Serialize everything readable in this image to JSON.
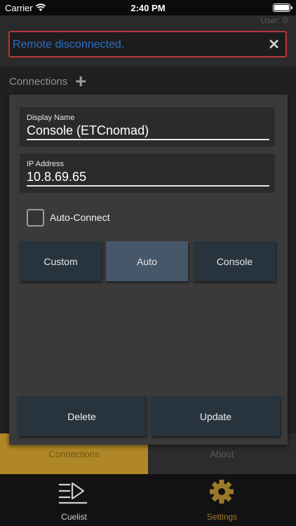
{
  "status_bar": {
    "carrier": "Carrier",
    "time": "2:40 PM"
  },
  "header": {
    "user_label": "User: 0",
    "alert": {
      "message": "Remote disconnected.",
      "close_glyph": "✕"
    }
  },
  "connections": {
    "label": "Connections",
    "add_glyph": "+"
  },
  "form": {
    "display_name": {
      "label": "Display Name",
      "value": "Console (ETCnomad)"
    },
    "ip_address": {
      "label": "IP Address",
      "value": "10.8.69.65"
    },
    "auto_connect": {
      "label": "Auto-Connect",
      "checked": false
    },
    "mode": {
      "options": [
        "Custom",
        "Auto",
        "Console"
      ],
      "selected": "Auto"
    },
    "delete_label": "Delete",
    "update_label": "Update"
  },
  "settings_tabs": {
    "connections": "Connections",
    "about": "About",
    "selected": "Connections"
  },
  "bottom_nav": {
    "cuelist": {
      "label": "Cuelist",
      "icon": "cuelist-icon"
    },
    "settings": {
      "label": "Settings",
      "icon": "gear-icon"
    },
    "selected": "Settings"
  },
  "colors": {
    "accent": "#b08726",
    "alert_border": "#b9363b",
    "alert_text": "#2d6ec7",
    "button": "#27333d",
    "button_selected": "#46576a"
  }
}
